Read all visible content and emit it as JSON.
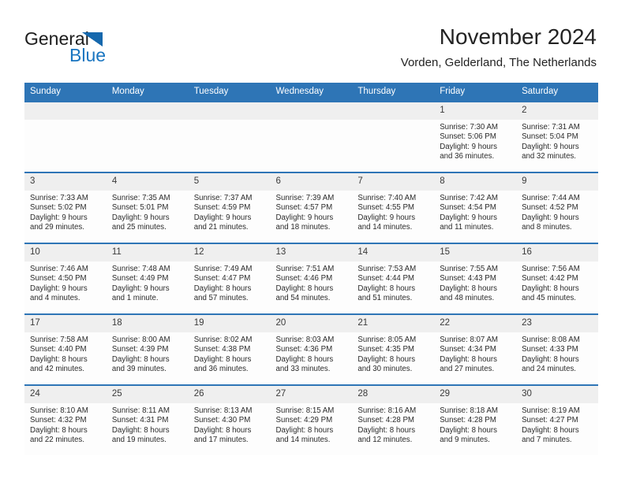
{
  "brand": {
    "word_general": "General",
    "word_blue": "Blue",
    "logo_icon": "triangle-logo",
    "accent_color": "#2e75b6",
    "blue_text_color": "#1975c0"
  },
  "header": {
    "title": "November 2024",
    "subtitle": "Vorden, Gelderland, The Netherlands"
  },
  "calendar": {
    "weekday_headers": [
      "Sunday",
      "Monday",
      "Tuesday",
      "Wednesday",
      "Thursday",
      "Friday",
      "Saturday"
    ],
    "weeks": [
      [
        {
          "day": "",
          "empty": true
        },
        {
          "day": "",
          "empty": true
        },
        {
          "day": "",
          "empty": true
        },
        {
          "day": "",
          "empty": true
        },
        {
          "day": "",
          "empty": true
        },
        {
          "day": "1",
          "sunrise": "Sunrise: 7:30 AM",
          "sunset": "Sunset: 5:06 PM",
          "daylight_1": "Daylight: 9 hours",
          "daylight_2": "and 36 minutes."
        },
        {
          "day": "2",
          "sunrise": "Sunrise: 7:31 AM",
          "sunset": "Sunset: 5:04 PM",
          "daylight_1": "Daylight: 9 hours",
          "daylight_2": "and 32 minutes."
        }
      ],
      [
        {
          "day": "3",
          "sunrise": "Sunrise: 7:33 AM",
          "sunset": "Sunset: 5:02 PM",
          "daylight_1": "Daylight: 9 hours",
          "daylight_2": "and 29 minutes."
        },
        {
          "day": "4",
          "sunrise": "Sunrise: 7:35 AM",
          "sunset": "Sunset: 5:01 PM",
          "daylight_1": "Daylight: 9 hours",
          "daylight_2": "and 25 minutes."
        },
        {
          "day": "5",
          "sunrise": "Sunrise: 7:37 AM",
          "sunset": "Sunset: 4:59 PM",
          "daylight_1": "Daylight: 9 hours",
          "daylight_2": "and 21 minutes."
        },
        {
          "day": "6",
          "sunrise": "Sunrise: 7:39 AM",
          "sunset": "Sunset: 4:57 PM",
          "daylight_1": "Daylight: 9 hours",
          "daylight_2": "and 18 minutes."
        },
        {
          "day": "7",
          "sunrise": "Sunrise: 7:40 AM",
          "sunset": "Sunset: 4:55 PM",
          "daylight_1": "Daylight: 9 hours",
          "daylight_2": "and 14 minutes."
        },
        {
          "day": "8",
          "sunrise": "Sunrise: 7:42 AM",
          "sunset": "Sunset: 4:54 PM",
          "daylight_1": "Daylight: 9 hours",
          "daylight_2": "and 11 minutes."
        },
        {
          "day": "9",
          "sunrise": "Sunrise: 7:44 AM",
          "sunset": "Sunset: 4:52 PM",
          "daylight_1": "Daylight: 9 hours",
          "daylight_2": "and 8 minutes."
        }
      ],
      [
        {
          "day": "10",
          "sunrise": "Sunrise: 7:46 AM",
          "sunset": "Sunset: 4:50 PM",
          "daylight_1": "Daylight: 9 hours",
          "daylight_2": "and 4 minutes."
        },
        {
          "day": "11",
          "sunrise": "Sunrise: 7:48 AM",
          "sunset": "Sunset: 4:49 PM",
          "daylight_1": "Daylight: 9 hours",
          "daylight_2": "and 1 minute."
        },
        {
          "day": "12",
          "sunrise": "Sunrise: 7:49 AM",
          "sunset": "Sunset: 4:47 PM",
          "daylight_1": "Daylight: 8 hours",
          "daylight_2": "and 57 minutes."
        },
        {
          "day": "13",
          "sunrise": "Sunrise: 7:51 AM",
          "sunset": "Sunset: 4:46 PM",
          "daylight_1": "Daylight: 8 hours",
          "daylight_2": "and 54 minutes."
        },
        {
          "day": "14",
          "sunrise": "Sunrise: 7:53 AM",
          "sunset": "Sunset: 4:44 PM",
          "daylight_1": "Daylight: 8 hours",
          "daylight_2": "and 51 minutes."
        },
        {
          "day": "15",
          "sunrise": "Sunrise: 7:55 AM",
          "sunset": "Sunset: 4:43 PM",
          "daylight_1": "Daylight: 8 hours",
          "daylight_2": "and 48 minutes."
        },
        {
          "day": "16",
          "sunrise": "Sunrise: 7:56 AM",
          "sunset": "Sunset: 4:42 PM",
          "daylight_1": "Daylight: 8 hours",
          "daylight_2": "and 45 minutes."
        }
      ],
      [
        {
          "day": "17",
          "sunrise": "Sunrise: 7:58 AM",
          "sunset": "Sunset: 4:40 PM",
          "daylight_1": "Daylight: 8 hours",
          "daylight_2": "and 42 minutes."
        },
        {
          "day": "18",
          "sunrise": "Sunrise: 8:00 AM",
          "sunset": "Sunset: 4:39 PM",
          "daylight_1": "Daylight: 8 hours",
          "daylight_2": "and 39 minutes."
        },
        {
          "day": "19",
          "sunrise": "Sunrise: 8:02 AM",
          "sunset": "Sunset: 4:38 PM",
          "daylight_1": "Daylight: 8 hours",
          "daylight_2": "and 36 minutes."
        },
        {
          "day": "20",
          "sunrise": "Sunrise: 8:03 AM",
          "sunset": "Sunset: 4:36 PM",
          "daylight_1": "Daylight: 8 hours",
          "daylight_2": "and 33 minutes."
        },
        {
          "day": "21",
          "sunrise": "Sunrise: 8:05 AM",
          "sunset": "Sunset: 4:35 PM",
          "daylight_1": "Daylight: 8 hours",
          "daylight_2": "and 30 minutes."
        },
        {
          "day": "22",
          "sunrise": "Sunrise: 8:07 AM",
          "sunset": "Sunset: 4:34 PM",
          "daylight_1": "Daylight: 8 hours",
          "daylight_2": "and 27 minutes."
        },
        {
          "day": "23",
          "sunrise": "Sunrise: 8:08 AM",
          "sunset": "Sunset: 4:33 PM",
          "daylight_1": "Daylight: 8 hours",
          "daylight_2": "and 24 minutes."
        }
      ],
      [
        {
          "day": "24",
          "sunrise": "Sunrise: 8:10 AM",
          "sunset": "Sunset: 4:32 PM",
          "daylight_1": "Daylight: 8 hours",
          "daylight_2": "and 22 minutes."
        },
        {
          "day": "25",
          "sunrise": "Sunrise: 8:11 AM",
          "sunset": "Sunset: 4:31 PM",
          "daylight_1": "Daylight: 8 hours",
          "daylight_2": "and 19 minutes."
        },
        {
          "day": "26",
          "sunrise": "Sunrise: 8:13 AM",
          "sunset": "Sunset: 4:30 PM",
          "daylight_1": "Daylight: 8 hours",
          "daylight_2": "and 17 minutes."
        },
        {
          "day": "27",
          "sunrise": "Sunrise: 8:15 AM",
          "sunset": "Sunset: 4:29 PM",
          "daylight_1": "Daylight: 8 hours",
          "daylight_2": "and 14 minutes."
        },
        {
          "day": "28",
          "sunrise": "Sunrise: 8:16 AM",
          "sunset": "Sunset: 4:28 PM",
          "daylight_1": "Daylight: 8 hours",
          "daylight_2": "and 12 minutes."
        },
        {
          "day": "29",
          "sunrise": "Sunrise: 8:18 AM",
          "sunset": "Sunset: 4:28 PM",
          "daylight_1": "Daylight: 8 hours",
          "daylight_2": "and 9 minutes."
        },
        {
          "day": "30",
          "sunrise": "Sunrise: 8:19 AM",
          "sunset": "Sunset: 4:27 PM",
          "daylight_1": "Daylight: 8 hours",
          "daylight_2": "and 7 minutes."
        }
      ]
    ]
  }
}
